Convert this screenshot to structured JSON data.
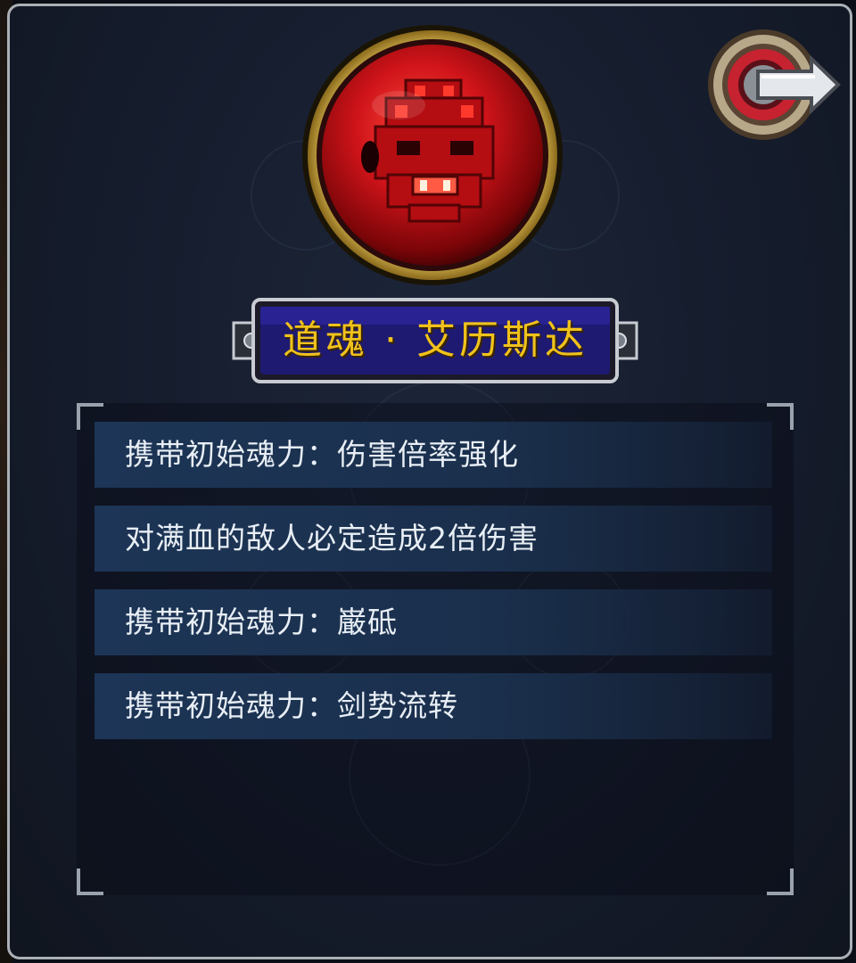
{
  "soul": {
    "title": "道魂 · 艾历斯达",
    "emblem_icon": "demon-mask-icon",
    "title_color": "#f0c21c"
  },
  "back_button": {
    "icon": "return-arrow-icon"
  },
  "effects": [
    {
      "text": "携带初始魂力：伤害倍率强化"
    },
    {
      "text": "对满血的敌人必定造成2倍伤害"
    },
    {
      "text": "携带初始魂力：巌砥"
    },
    {
      "text": "携带初始魂力：剑势流转"
    }
  ],
  "colors": {
    "panel_bg": "#151c2c",
    "panel_border": "#aab0b6",
    "row_bg": "#1d3556",
    "orb_red": "#d0141a",
    "orb_rim_gold": "#c9a23a"
  }
}
